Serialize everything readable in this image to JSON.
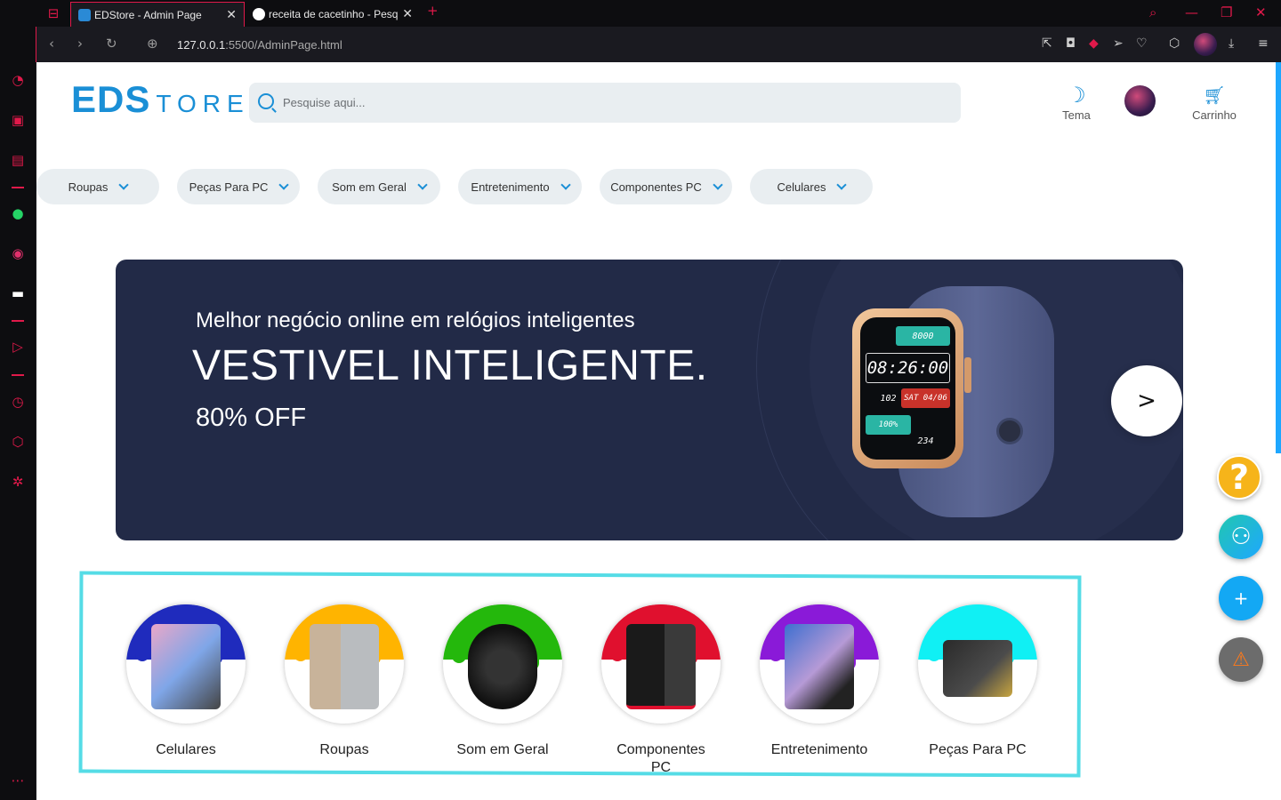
{
  "browser": {
    "tabs": [
      {
        "title": "EDStore - Admin Page",
        "active": true
      },
      {
        "title": "receita de cacetinho - Pesq",
        "active": false
      }
    ],
    "url_host": "127.0.0.1",
    "url_rest": ":5500/AdminPage.html"
  },
  "logo": {
    "bold": "EDS",
    "rest": "TORE"
  },
  "search": {
    "placeholder": "Pesquise aqui..."
  },
  "header": {
    "theme_label": "Tema",
    "cart_label": "Carrinho"
  },
  "categories_nav": [
    "Roupas",
    "Peças Para PC",
    "Som em Geral",
    "Entretenimento",
    "Componentes PC",
    "Celulares"
  ],
  "banner": {
    "subtitle": "Melhor negócio online em relógios inteligentes",
    "title": "VESTIVEL INTELIGENTE.",
    "discount": "80% OFF",
    "next_label": ">",
    "watch": {
      "steps": "8000",
      "time": "08:26:00",
      "hr": "102",
      "date": "SAT 04/06",
      "battery": "100%",
      "cal": "234"
    }
  },
  "category_circles": [
    {
      "label": "Celulares",
      "color": "#1f2bbd"
    },
    {
      "label": "Roupas",
      "color": "#ffb400"
    },
    {
      "label": "Som em Geral",
      "color": "#24b80c"
    },
    {
      "label": "Componentes PC",
      "color": "#e0102e"
    },
    {
      "label": "Entretenimento",
      "color": "#8a1ad8"
    },
    {
      "label": "Peças Para PC",
      "color": "#10f0f4"
    }
  ],
  "fabs": {
    "help": "?",
    "add": "+",
    "alert": "!"
  },
  "colors": {
    "accent": "#1a8fd6",
    "browser_accent": "#e0194a",
    "banner_bg": "#222a47"
  }
}
